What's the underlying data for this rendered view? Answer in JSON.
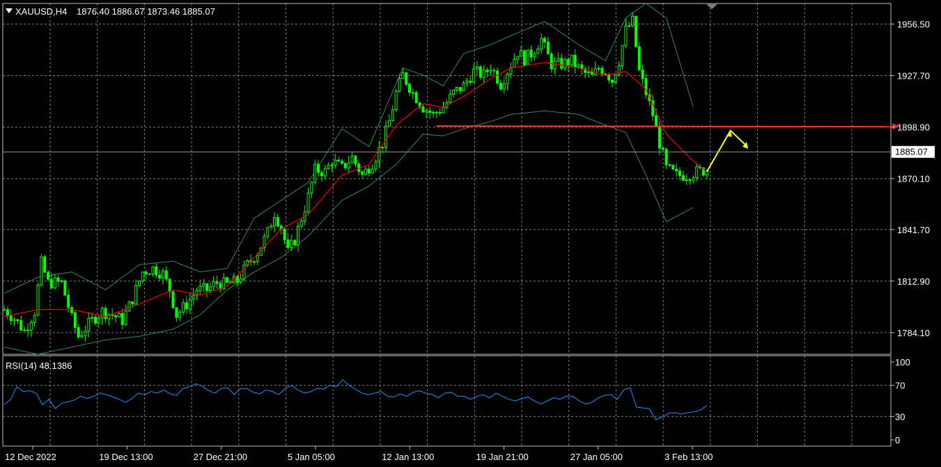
{
  "header": {
    "symbol": "XAUUSD,H4",
    "ohlc": "1876.40 1886.67 1873.46 1885.07",
    "rsi_label": "RSI(14) 48.1386"
  },
  "colors": {
    "background": "#000000",
    "grid": "#7f7f7f",
    "bull_candle": "#00ff00",
    "bear_candle": "#00ff00",
    "bollinger": "#2e8b57",
    "moving_average": "#ff0000",
    "rsi_line": "#1e90ff",
    "resistance_line": "#ff3030",
    "forecast_arrow": "#ffff00",
    "current_price_box": "#ffffff"
  },
  "chart_data": [
    {
      "type": "candlestick",
      "title": "XAUUSD,H4",
      "ylim": [
        1772,
        1968
      ],
      "yticks": [
        "1956.50",
        "1927.70",
        "1898.90",
        "1870.10",
        "1841.70",
        "1812.90",
        "1784.10"
      ],
      "ytick_values": [
        1956.5,
        1927.7,
        1898.9,
        1870.1,
        1841.7,
        1812.9,
        1784.1
      ],
      "current_price": "1885.07",
      "current_price_value": 1885.07,
      "xticks": [
        "12 Dec 2022",
        "19 Dec 13:00",
        "27 Dec 21:00",
        "5 Jan 05:00",
        "12 Jan 13:00",
        "19 Jan 21:00",
        "27 Jan 05:00",
        "3 Feb 13:00"
      ],
      "price_path": [
        [
          0,
          1797
        ],
        [
          3,
          1792
        ],
        [
          6,
          1785
        ],
        [
          9,
          1796
        ],
        [
          11,
          1823
        ],
        [
          13,
          1812
        ],
        [
          17,
          1812
        ],
        [
          20,
          1792
        ],
        [
          22,
          1782
        ],
        [
          26,
          1791
        ],
        [
          29,
          1796
        ],
        [
          32,
          1794
        ],
        [
          35,
          1791
        ],
        [
          38,
          1803
        ],
        [
          41,
          1818
        ],
        [
          44,
          1820
        ],
        [
          47,
          1817
        ],
        [
          49,
          1808
        ],
        [
          51,
          1794
        ],
        [
          54,
          1800
        ],
        [
          57,
          1808
        ],
        [
          60,
          1808
        ],
        [
          63,
          1812
        ],
        [
          66,
          1811
        ],
        [
          69,
          1813
        ],
        [
          72,
          1822
        ],
        [
          75,
          1829
        ],
        [
          78,
          1840
        ],
        [
          80,
          1851
        ],
        [
          82,
          1843
        ],
        [
          84,
          1829
        ],
        [
          86,
          1836
        ],
        [
          88,
          1848
        ],
        [
          90,
          1860
        ],
        [
          92,
          1875
        ],
        [
          95,
          1874
        ],
        [
          97,
          1880
        ],
        [
          100,
          1876
        ],
        [
          103,
          1882
        ],
        [
          106,
          1872
        ],
        [
          109,
          1879
        ],
        [
          112,
          1890
        ],
        [
          114,
          1902
        ],
        [
          116,
          1918
        ],
        [
          118,
          1928
        ],
        [
          121,
          1918
        ],
        [
          124,
          1910
        ],
        [
          127,
          1906
        ],
        [
          130,
          1910
        ],
        [
          133,
          1918
        ],
        [
          136,
          1922
        ],
        [
          139,
          1930
        ],
        [
          142,
          1928
        ],
        [
          144,
          1933
        ],
        [
          147,
          1923
        ],
        [
          150,
          1934
        ],
        [
          152,
          1941
        ],
        [
          154,
          1937
        ],
        [
          156,
          1940
        ],
        [
          159,
          1948
        ],
        [
          162,
          1934
        ],
        [
          165,
          1934
        ],
        [
          168,
          1936
        ],
        [
          171,
          1930
        ],
        [
          174,
          1927
        ],
        [
          176,
          1932
        ],
        [
          178,
          1930
        ],
        [
          180,
          1925
        ],
        [
          182,
          1936
        ],
        [
          184,
          1953
        ],
        [
          186,
          1958
        ],
        [
          188,
          1930
        ],
        [
          190,
          1918
        ],
        [
          192,
          1906
        ],
        [
          194,
          1890
        ],
        [
          196,
          1876
        ],
        [
          199,
          1872
        ],
        [
          202,
          1872
        ],
        [
          205,
          1874
        ],
        [
          208,
          1875
        ]
      ],
      "last_index": 208,
      "bollinger_upper": [
        [
          0,
          1806
        ],
        [
          10,
          1815
        ],
        [
          20,
          1818
        ],
        [
          30,
          1808
        ],
        [
          40,
          1822
        ],
        [
          50,
          1824
        ],
        [
          58,
          1818
        ],
        [
          66,
          1820
        ],
        [
          74,
          1848
        ],
        [
          82,
          1858
        ],
        [
          90,
          1868
        ],
        [
          100,
          1898
        ],
        [
          108,
          1888
        ],
        [
          118,
          1932
        ],
        [
          124,
          1928
        ],
        [
          130,
          1922
        ],
        [
          136,
          1940
        ],
        [
          144,
          1945
        ],
        [
          150,
          1950
        ],
        [
          160,
          1958
        ],
        [
          170,
          1945
        ],
        [
          178,
          1936
        ],
        [
          184,
          1960
        ],
        [
          190,
          1968
        ],
        [
          196,
          1960
        ],
        [
          204,
          1910
        ]
      ],
      "bollinger_lower": [
        [
          0,
          1776
        ],
        [
          10,
          1772
        ],
        [
          20,
          1776
        ],
        [
          30,
          1780
        ],
        [
          40,
          1782
        ],
        [
          50,
          1786
        ],
        [
          58,
          1794
        ],
        [
          66,
          1808
        ],
        [
          74,
          1818
        ],
        [
          82,
          1826
        ],
        [
          90,
          1838
        ],
        [
          100,
          1858
        ],
        [
          108,
          1866
        ],
        [
          116,
          1878
        ],
        [
          124,
          1895
        ],
        [
          130,
          1894
        ],
        [
          136,
          1898
        ],
        [
          144,
          1902
        ],
        [
          150,
          1906
        ],
        [
          160,
          1908
        ],
        [
          170,
          1906
        ],
        [
          178,
          1900
        ],
        [
          184,
          1896
        ],
        [
          190,
          1872
        ],
        [
          196,
          1846
        ],
        [
          204,
          1854
        ]
      ],
      "moving_average": [
        [
          0,
          1793
        ],
        [
          10,
          1797
        ],
        [
          20,
          1797
        ],
        [
          30,
          1793
        ],
        [
          40,
          1800
        ],
        [
          50,
          1808
        ],
        [
          58,
          1805
        ],
        [
          66,
          1810
        ],
        [
          74,
          1826
        ],
        [
          82,
          1842
        ],
        [
          90,
          1850
        ],
        [
          100,
          1872
        ],
        [
          108,
          1878
        ],
        [
          116,
          1900
        ],
        [
          124,
          1912
        ],
        [
          130,
          1910
        ],
        [
          136,
          1916
        ],
        [
          144,
          1926
        ],
        [
          150,
          1932
        ],
        [
          160,
          1935
        ],
        [
          170,
          1932
        ],
        [
          178,
          1928
        ],
        [
          184,
          1930
        ],
        [
          190,
          1920
        ],
        [
          196,
          1895
        ],
        [
          204,
          1880
        ],
        [
          208,
          1874
        ]
      ],
      "resistance_line": {
        "price": 1899.5,
        "from_index": 128,
        "to_index": 265
      },
      "forecast_arrow": [
        [
          208,
          1874
        ],
        [
          215,
          1897
        ],
        [
          220,
          1888
        ]
      ]
    },
    {
      "type": "line",
      "title": "RSI(14) 48.1386",
      "ylim": [
        0,
        100
      ],
      "yticks": [
        "100",
        "70",
        "30",
        "0"
      ],
      "ytick_values": [
        100,
        70,
        30,
        0
      ],
      "values": [
        45,
        52,
        68,
        62,
        63,
        60,
        45,
        52,
        40,
        47,
        49,
        51,
        56,
        53,
        56,
        60,
        58,
        55,
        52,
        48,
        53,
        60,
        58,
        62,
        60,
        64,
        59,
        57,
        66,
        68,
        72,
        69,
        63,
        60,
        66,
        67,
        58,
        66,
        66,
        61,
        59,
        64,
        62,
        58,
        66,
        70,
        64,
        60,
        62,
        66,
        65,
        70,
        68,
        77,
        70,
        65,
        60,
        58,
        60,
        62,
        56,
        55,
        59,
        56,
        61,
        63,
        60,
        58,
        54,
        60,
        61,
        56,
        56,
        52,
        56,
        58,
        54,
        60,
        56,
        52,
        50,
        53,
        55,
        50,
        46,
        50,
        54,
        52,
        56,
        56,
        50,
        46,
        48,
        54,
        57,
        58,
        52,
        64,
        67,
        42,
        41,
        40,
        26,
        29,
        34,
        35,
        33,
        35,
        36,
        38,
        44
      ]
    }
  ]
}
